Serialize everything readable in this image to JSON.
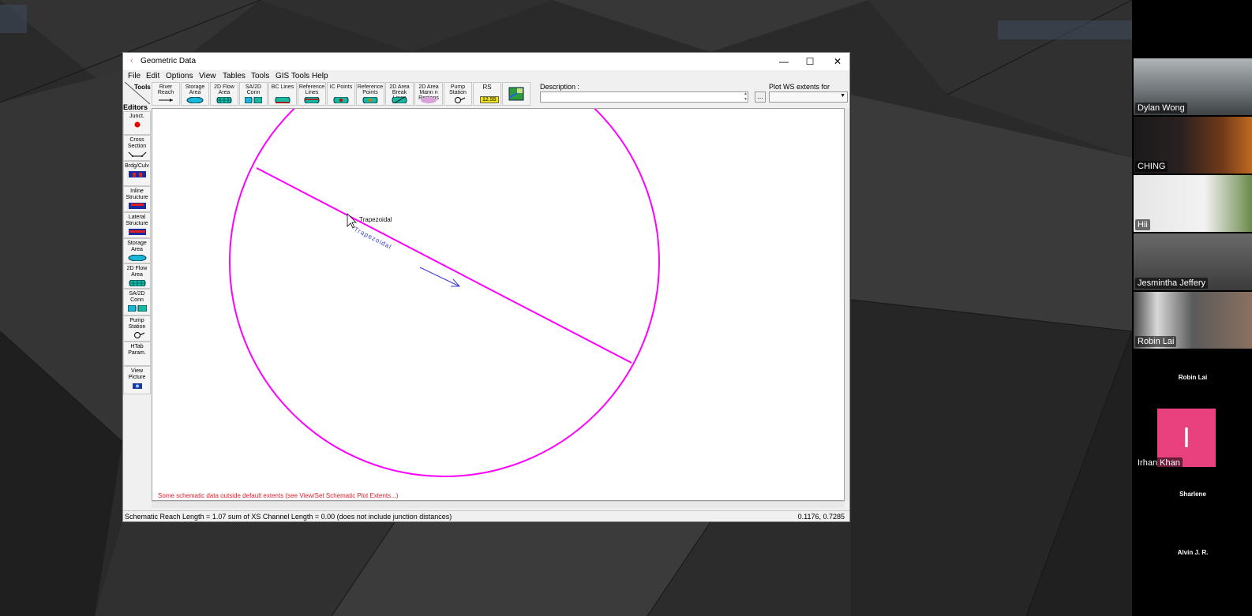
{
  "window": {
    "title": "Geometric Data",
    "minimize_glyph": "—",
    "maximize_glyph": "☐",
    "close_glyph": "✕"
  },
  "menu": [
    "File",
    "Edit",
    "Options",
    "View",
    "Tables",
    "Tools",
    "GIS Tools",
    "Help"
  ],
  "toolbar": {
    "corner_label": "Tools",
    "buttons": [
      {
        "label": "River Reach",
        "icon": "river-reach-icon"
      },
      {
        "label": "Storage Area",
        "icon": "storage-area-icon"
      },
      {
        "label": "2D Flow Area",
        "icon": "2d-flow-area-icon"
      },
      {
        "label": "SA/2D Conn",
        "icon": "sa-2d-conn-icon"
      },
      {
        "label": "BC Lines",
        "icon": "bc-lines-icon"
      },
      {
        "label": "Reference Lines",
        "icon": "reference-lines-icon"
      },
      {
        "label": "IC Points",
        "icon": "ic-points-icon"
      },
      {
        "label": "Reference Points",
        "icon": "reference-points-icon"
      },
      {
        "label": "2D Area Break Lines",
        "icon": "break-lines-icon"
      },
      {
        "label": "2D Area Mann n Regions",
        "icon": "mann-n-regions-icon"
      },
      {
        "label": "Pump Station",
        "icon": "pump-station-icon"
      },
      {
        "label": "RS",
        "sublabel": "12.55",
        "icon": "river-station-icon"
      },
      {
        "label": "",
        "icon": "map-layers-icon"
      }
    ],
    "description_label": "Description :",
    "description_value": "",
    "description_browse": "...",
    "plot_ws_label": "Plot WS extents for Profile:",
    "plot_ws_value": ""
  },
  "editors": {
    "label": "Editors",
    "buttons": [
      {
        "label": "Junct.",
        "icon": "junction-icon"
      },
      {
        "label": "Cross Section",
        "icon": "cross-section-icon"
      },
      {
        "label": "Brdg/Culv",
        "icon": "bridge-culvert-icon"
      },
      {
        "label": "Inline Structure",
        "icon": "inline-structure-icon"
      },
      {
        "label": "Lateral Structure",
        "icon": "lateral-structure-icon"
      },
      {
        "label": "Storage Area",
        "icon": "storage-area-icon"
      },
      {
        "label": "2D Flow Area",
        "icon": "2d-flow-area-icon"
      },
      {
        "label": "SA/2D Conn",
        "icon": "sa-2d-conn-icon"
      },
      {
        "label": "Pump Station",
        "icon": "pump-station-icon"
      },
      {
        "label": "HTab Param.",
        "icon": ""
      },
      {
        "label": "View Picture",
        "icon": "camera-icon"
      }
    ]
  },
  "canvas": {
    "river_label": "Trapezoidal",
    "reach_label": "Trapezoidal",
    "warning": "Some schematic data outside default extents (see View/Set Schematic Plot Extents...)",
    "colors": {
      "circle": "#ff00ff",
      "reach": "#ff00ff",
      "arrow": "#3a3ad8",
      "warning": "#e0202a"
    }
  },
  "status": {
    "left": "Schematic Reach Length = 1.07  sum of XS Channel Length = 0.00 (does not include junction distances)",
    "right": "0.1176, 0.7285"
  },
  "participants": [
    {
      "name": "Dylan Wong",
      "type": "video"
    },
    {
      "name": "CHING",
      "type": "video"
    },
    {
      "name": "Hii",
      "type": "video"
    },
    {
      "name": "Jesmintha Jeffery",
      "type": "video"
    },
    {
      "name": "Robin Lai",
      "type": "video"
    },
    {
      "name": "Robin Lai",
      "type": "name-only"
    },
    {
      "name": "Irhan Khan",
      "type": "avatar",
      "initial": "I"
    },
    {
      "name": "Sharlene",
      "type": "name-only"
    },
    {
      "name": "Alvin J. R.",
      "type": "name-only"
    }
  ]
}
